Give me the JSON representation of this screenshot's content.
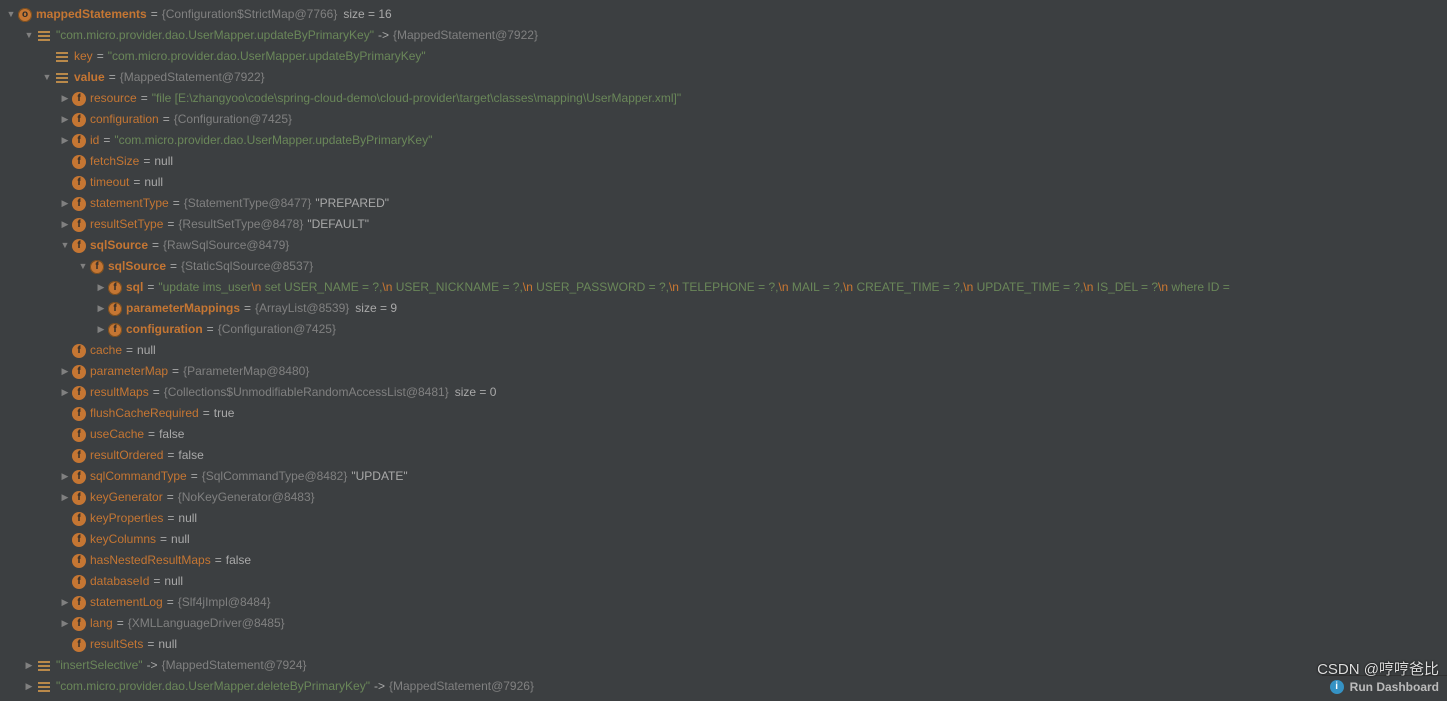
{
  "root": {
    "name": "mappedStatements",
    "valueRef": "{Configuration$StrictMap@7766}",
    "sizeLabel": "size = 16"
  },
  "entry0": {
    "keyStr": "\"com.micro.provider.dao.UserMapper.updateByPrimaryKey\"",
    "arrow": "->",
    "valueRef": "{MappedStatement@7922}",
    "key": {
      "name": "key",
      "value": "\"com.micro.provider.dao.UserMapper.updateByPrimaryKey\""
    },
    "value": {
      "name": "value",
      "valueRef": "{MappedStatement@7922}"
    }
  },
  "fields": {
    "resource": {
      "name": "resource",
      "value": "\"file [E:\\zhangyoo\\code\\spring-cloud-demo\\cloud-provider\\target\\classes\\mapping\\UserMapper.xml]\""
    },
    "configuration": {
      "name": "configuration",
      "valueRef": "{Configuration@7425}"
    },
    "id": {
      "name": "id",
      "value": "\"com.micro.provider.dao.UserMapper.updateByPrimaryKey\""
    },
    "fetchSize": {
      "name": "fetchSize",
      "value": "null"
    },
    "timeout": {
      "name": "timeout",
      "value": "null"
    },
    "statementType": {
      "name": "statementType",
      "valueRef": "{StatementType@8477}",
      "literal": "\"PREPARED\""
    },
    "resultSetType": {
      "name": "resultSetType",
      "valueRef": "{ResultSetType@8478}",
      "literal": "\"DEFAULT\""
    },
    "sqlSource": {
      "name": "sqlSource",
      "valueRef": "{RawSqlSource@8479}"
    },
    "cache": {
      "name": "cache",
      "value": "null"
    },
    "parameterMap": {
      "name": "parameterMap",
      "valueRef": "{ParameterMap@8480}"
    },
    "resultMaps": {
      "name": "resultMaps",
      "valueRef": "{Collections$UnmodifiableRandomAccessList@8481}",
      "sizeLabel": "size = 0"
    },
    "flushCacheRequired": {
      "name": "flushCacheRequired",
      "value": "true"
    },
    "useCache": {
      "name": "useCache",
      "value": "false"
    },
    "resultOrdered": {
      "name": "resultOrdered",
      "value": "false"
    },
    "sqlCommandType": {
      "name": "sqlCommandType",
      "valueRef": "{SqlCommandType@8482}",
      "literal": "\"UPDATE\""
    },
    "keyGenerator": {
      "name": "keyGenerator",
      "valueRef": "{NoKeyGenerator@8483}"
    },
    "keyProperties": {
      "name": "keyProperties",
      "value": "null"
    },
    "keyColumns": {
      "name": "keyColumns",
      "value": "null"
    },
    "hasNestedResultMaps": {
      "name": "hasNestedResultMaps",
      "value": "false"
    },
    "databaseId": {
      "name": "databaseId",
      "value": "null"
    },
    "statementLog": {
      "name": "statementLog",
      "valueRef": "{Slf4jImpl@8484}"
    },
    "lang": {
      "name": "lang",
      "valueRef": "{XMLLanguageDriver@8485}"
    },
    "resultSets": {
      "name": "resultSets",
      "value": "null"
    }
  },
  "inner": {
    "sqlSource": {
      "name": "sqlSource",
      "valueRef": "{StaticSqlSource@8537}"
    },
    "sql": {
      "name": "sql",
      "parts": [
        {
          "t": "g",
          "v": "\"update ims_user"
        },
        {
          "t": "e",
          "v": "\\n"
        },
        {
          "t": "g",
          "v": "    set USER_NAME = ?,"
        },
        {
          "t": "e",
          "v": "\\n"
        },
        {
          "t": "g",
          "v": "      USER_NICKNAME = ?,"
        },
        {
          "t": "e",
          "v": "\\n"
        },
        {
          "t": "g",
          "v": "      USER_PASSWORD = ?,"
        },
        {
          "t": "e",
          "v": "\\n"
        },
        {
          "t": "g",
          "v": "      TELEPHONE = ?,"
        },
        {
          "t": "e",
          "v": "\\n"
        },
        {
          "t": "g",
          "v": "      MAIL = ?,"
        },
        {
          "t": "e",
          "v": "\\n"
        },
        {
          "t": "g",
          "v": "      CREATE_TIME = ?,"
        },
        {
          "t": "e",
          "v": "\\n"
        },
        {
          "t": "g",
          "v": "      UPDATE_TIME = ?,"
        },
        {
          "t": "e",
          "v": "\\n"
        },
        {
          "t": "g",
          "v": "      IS_DEL = ?"
        },
        {
          "t": "e",
          "v": "\\n"
        },
        {
          "t": "g",
          "v": "    where ID ="
        }
      ]
    },
    "parameterMappings": {
      "name": "parameterMappings",
      "valueRef": "{ArrayList@8539}",
      "sizeLabel": "size = 9"
    },
    "configuration": {
      "name": "configuration",
      "valueRef": "{Configuration@7425}"
    }
  },
  "entry1": {
    "keyStr": "\"insertSelective\"",
    "arrow": "->",
    "valueRef": "{MappedStatement@7924}"
  },
  "entry2": {
    "keyStr": "\"com.micro.provider.dao.UserMapper.deleteByPrimaryKey\"",
    "arrow": "->",
    "valueRef": "{MappedStatement@7926}"
  },
  "footer": {
    "label": "Run Dashboard"
  },
  "watermark": "CSDN @哼哼爸比"
}
